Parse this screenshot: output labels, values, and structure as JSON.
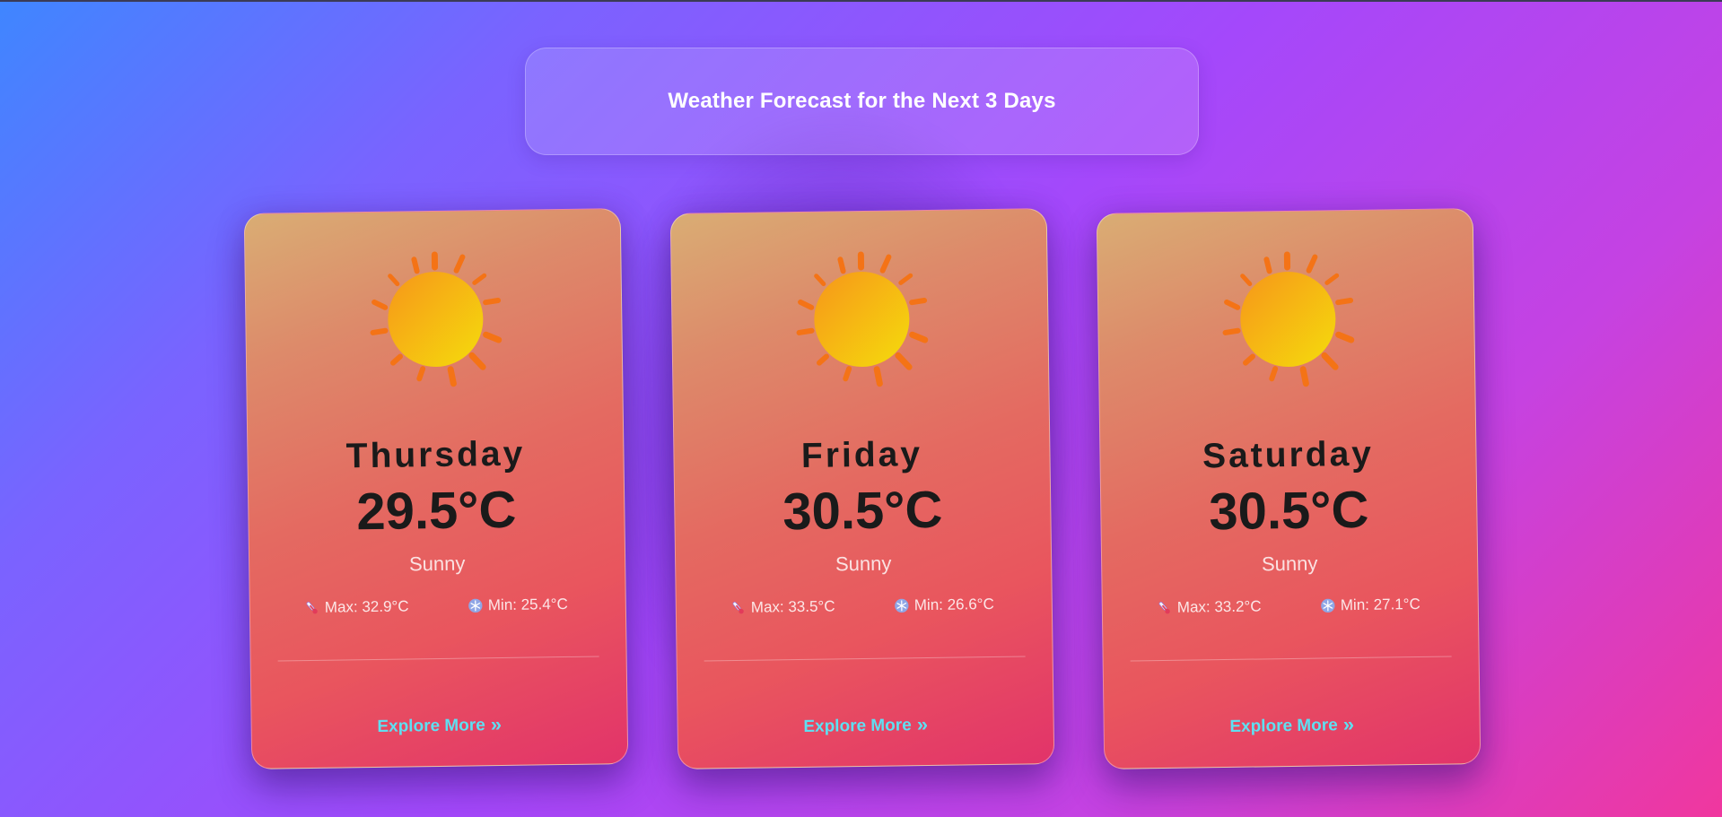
{
  "header": {
    "title": "Weather Forecast for the Next 3 Days"
  },
  "colors": {
    "explore_link": "#5ee0f2",
    "sun_core": "#f7c21b",
    "sun_rays": "#f47316"
  },
  "cards": [
    {
      "day": "Thursday",
      "temp": "29.5°C",
      "condition": "Sunny",
      "max": "Max: 32.9°C",
      "min": "Min: 25.4°C",
      "icon": "sun-icon",
      "link": "Explore More"
    },
    {
      "day": "Friday",
      "temp": "30.5°C",
      "condition": "Sunny",
      "max": "Max: 33.5°C",
      "min": "Min: 26.6°C",
      "icon": "sun-icon",
      "link": "Explore More"
    },
    {
      "day": "Saturday",
      "temp": "30.5°C",
      "condition": "Sunny",
      "max": "Max: 33.2°C",
      "min": "Min: 27.1°C",
      "icon": "sun-icon",
      "link": "Explore More"
    }
  ]
}
